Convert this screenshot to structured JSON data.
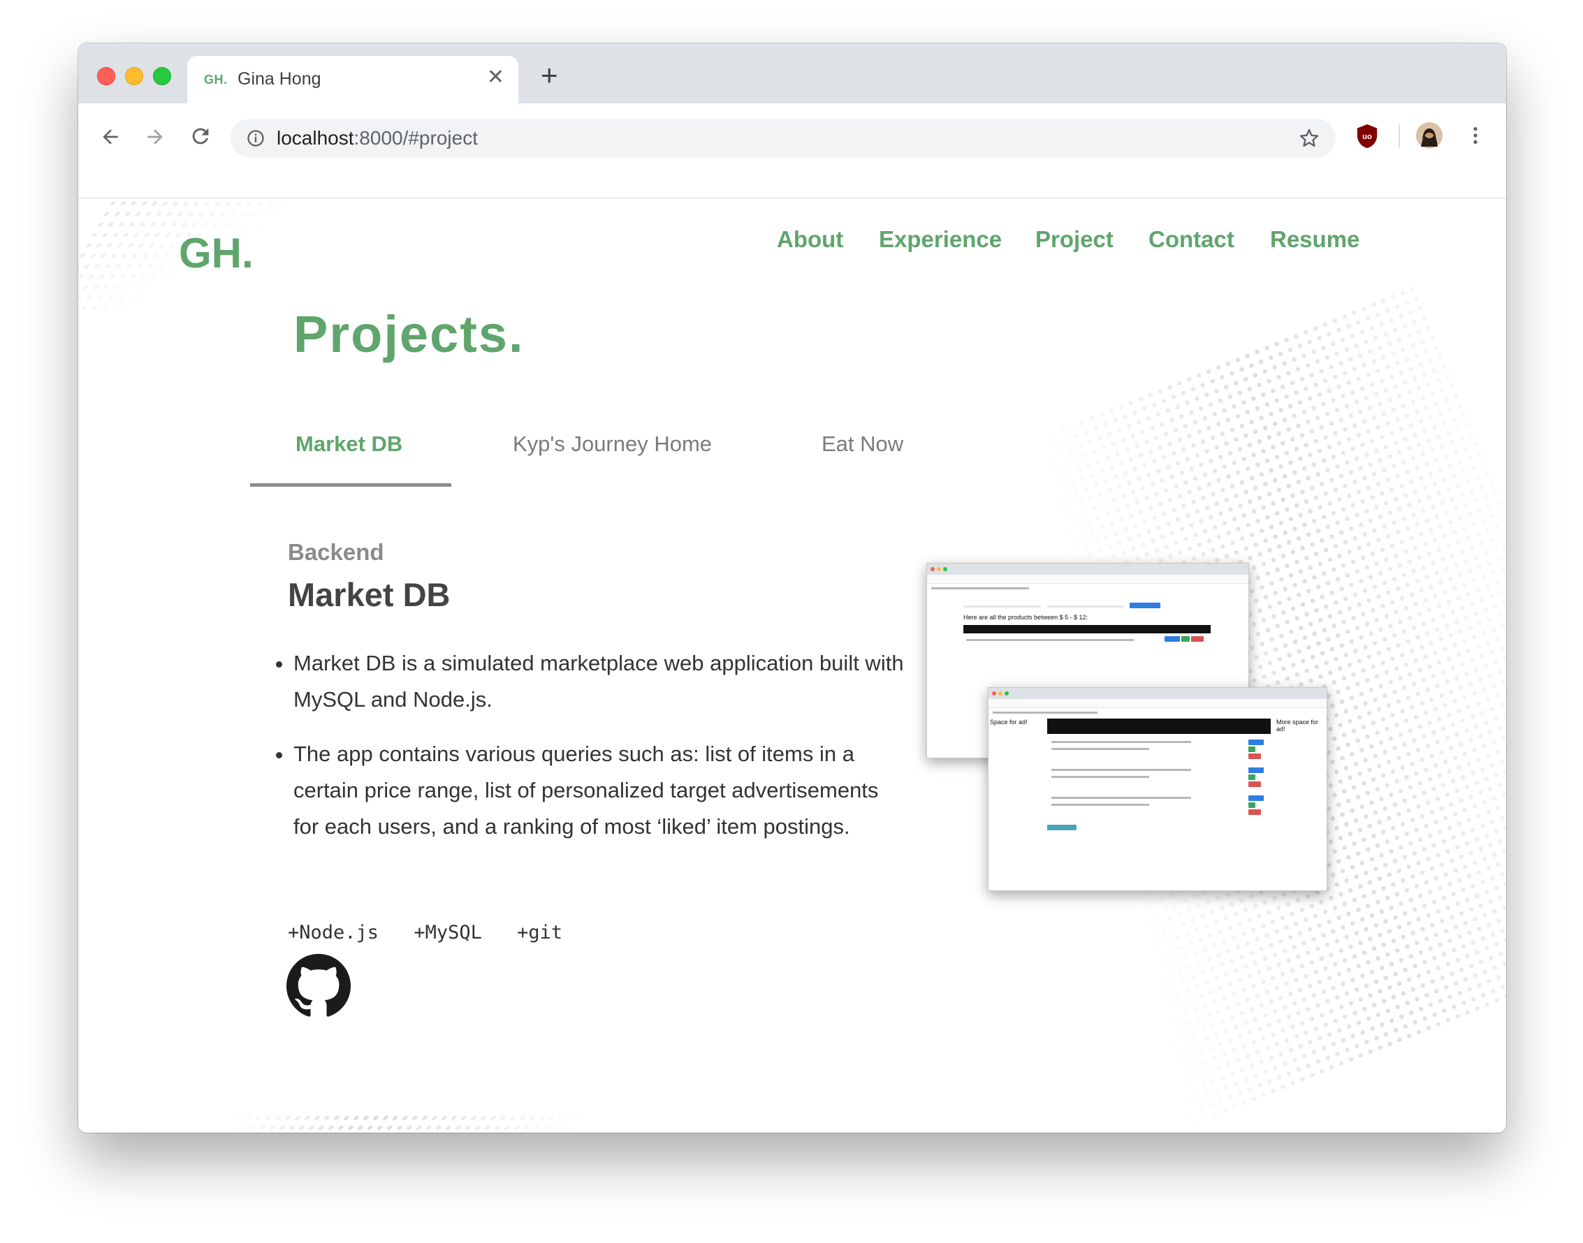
{
  "browser": {
    "tab_favicon": "GH.",
    "tab_title": "Gina Hong",
    "tab_close_icon": "✕",
    "new_tab_icon": "+",
    "url_host": "localhost",
    "url_rest": ":8000/#project"
  },
  "site": {
    "logo": "GH.",
    "nav": [
      "About",
      "Experience",
      "Project",
      "Contact",
      "Resume"
    ]
  },
  "projects": {
    "heading": "Projects.",
    "tabs": [
      "Market DB",
      "Kyp's Journey Home",
      "Eat Now"
    ],
    "active_tab": 0,
    "detail": {
      "category": "Backend",
      "name": "Market DB",
      "bullets": [
        "Market DB is a simulated marketplace web application built with MySQL and Node.js.",
        "The app contains various queries such as: list of items in a certain price range, list of personalized target advertisements for each users, and a ranking of most ‘liked’ item postings."
      ],
      "tags": [
        "+Node.js",
        "+MySQL",
        "+git"
      ],
      "github_icon": "github-icon"
    },
    "screenshots": {
      "back_heading": "Here are all the products between $ 5 - $ 12:",
      "front_left_ad": "Space for ad!",
      "front_right_ad": "More space for ad!"
    }
  },
  "colors": {
    "accent": "#5fa56c",
    "text": "#333333",
    "muted": "#8a8a8a"
  }
}
